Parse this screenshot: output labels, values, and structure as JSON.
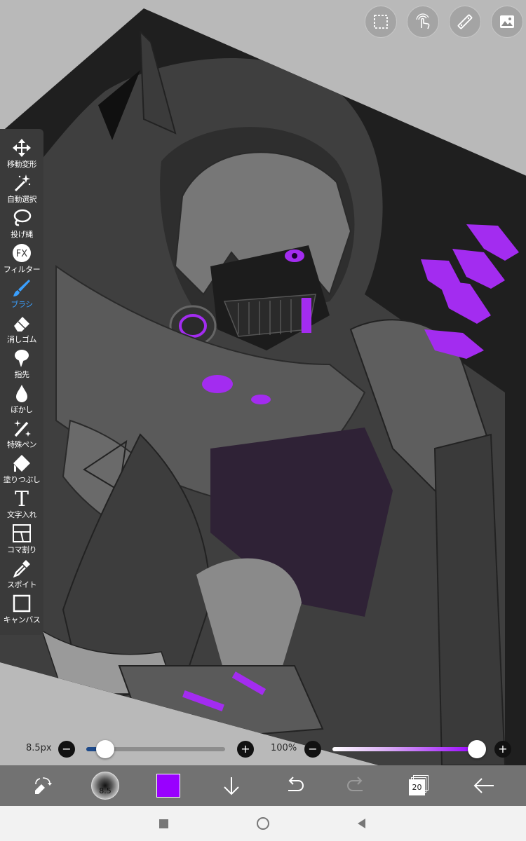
{
  "app": {
    "accent": "#3aa0ff",
    "brush_color": "#9900ff",
    "glow": "#a32cf0"
  },
  "top_toolbar": [
    {
      "name": "selection-icon"
    },
    {
      "name": "touch-icon"
    },
    {
      "name": "ruler-icon"
    },
    {
      "name": "image-icon"
    }
  ],
  "tools": [
    {
      "id": "move-transform",
      "label": "移動変形",
      "icon": "move-arrows-icon"
    },
    {
      "id": "magic-wand",
      "label": "自動選択",
      "icon": "magic-wand-icon"
    },
    {
      "id": "lasso",
      "label": "投げ縄",
      "icon": "lasso-icon"
    },
    {
      "id": "filter",
      "label": "フィルター",
      "icon": "fx-icon"
    },
    {
      "id": "brush",
      "label": "ブラシ",
      "icon": "brush-icon",
      "active": true
    },
    {
      "id": "eraser",
      "label": "消しゴム",
      "icon": "eraser-icon"
    },
    {
      "id": "finger",
      "label": "指先",
      "icon": "finger-icon"
    },
    {
      "id": "blur",
      "label": "ぼかし",
      "icon": "drop-icon"
    },
    {
      "id": "special-pen",
      "label": "特殊ペン",
      "icon": "sparkle-pen-icon"
    },
    {
      "id": "fill",
      "label": "塗りつぶし",
      "icon": "bucket-icon"
    },
    {
      "id": "text",
      "label": "文字入れ",
      "icon": "text-icon"
    },
    {
      "id": "frame-divider",
      "label": "コマ割り",
      "icon": "panels-icon"
    },
    {
      "id": "eyedropper",
      "label": "スポイト",
      "icon": "eyedropper-icon"
    },
    {
      "id": "canvas",
      "label": "キャンバス",
      "icon": "canvas-icon"
    }
  ],
  "brush_size": {
    "text": "8.5px",
    "value_fraction": 0.13
  },
  "opacity": {
    "text": "100%",
    "value_fraction": 1.0
  },
  "bottom_bar": {
    "brush_size_badge": "8.5",
    "layers_count": "20"
  }
}
